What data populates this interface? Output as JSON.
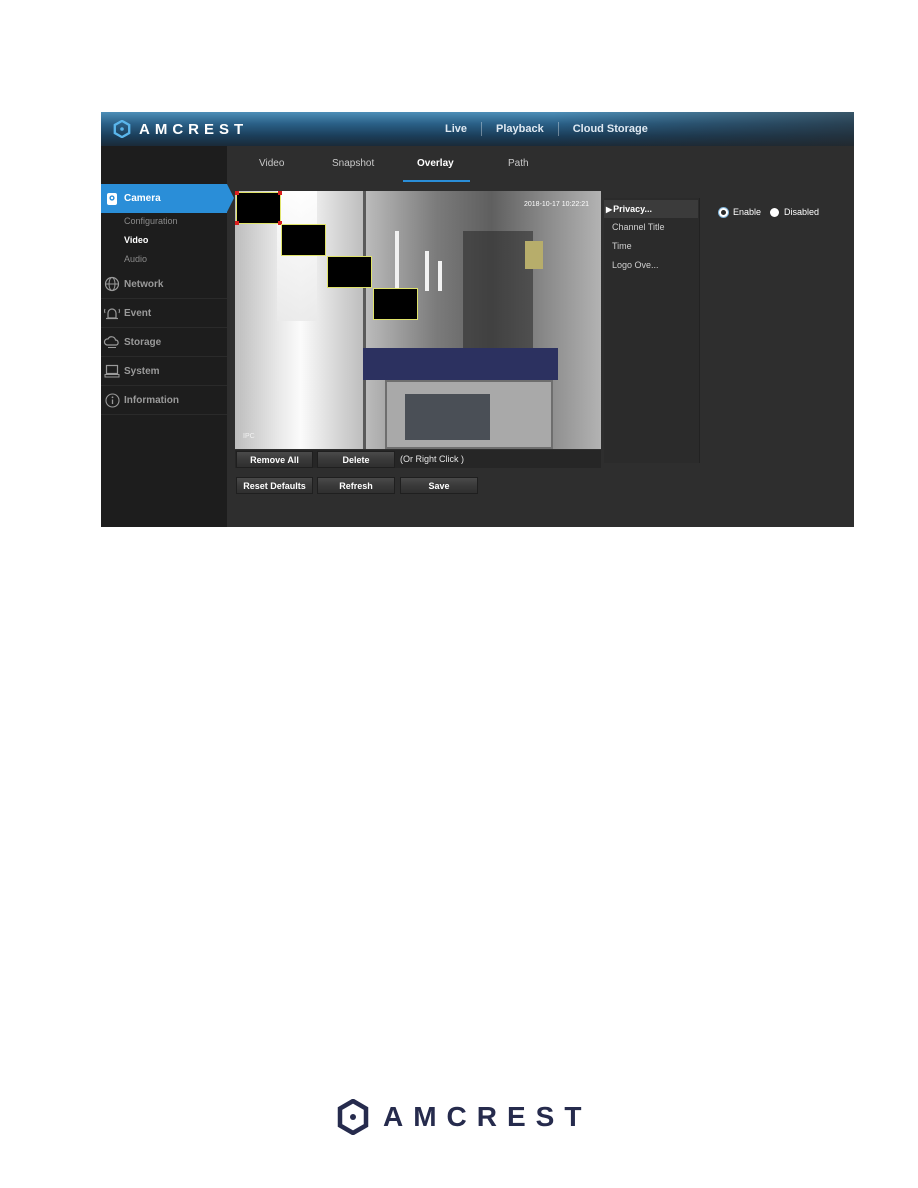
{
  "header": {
    "brand": "AMCREST",
    "nav": [
      {
        "label": "Live"
      },
      {
        "label": "Playback"
      },
      {
        "label": "Cloud Storage"
      }
    ]
  },
  "sidebar": {
    "items": [
      {
        "label": "Camera",
        "icon": "camera-icon",
        "active": true,
        "sub": [
          {
            "label": "Configuration",
            "active": false
          },
          {
            "label": "Video",
            "active": true
          },
          {
            "label": "Audio",
            "active": false
          }
        ]
      },
      {
        "label": "Network",
        "icon": "network-globe-icon"
      },
      {
        "label": "Event",
        "icon": "alarm-bell-icon"
      },
      {
        "label": "Storage",
        "icon": "cloud-icon"
      },
      {
        "label": "System",
        "icon": "computer-icon"
      },
      {
        "label": "Information",
        "icon": "info-icon"
      }
    ]
  },
  "tabs": [
    {
      "label": "Video",
      "active": false
    },
    {
      "label": "Snapshot",
      "active": false
    },
    {
      "label": "Overlay",
      "active": true
    },
    {
      "label": "Path",
      "active": false
    }
  ],
  "video": {
    "timestamp": "2018-10-17 10:22:21",
    "channel_label": "IPC",
    "privacy_masks": 4
  },
  "buttons": {
    "remove_all": "Remove All",
    "delete": "Delete",
    "delete_hint": "(Or Right Click )",
    "reset_defaults": "Reset Defaults",
    "refresh": "Refresh",
    "save": "Save"
  },
  "overlay_list": [
    {
      "label": "Privacy...",
      "active": true
    },
    {
      "label": "Channel Title",
      "active": false
    },
    {
      "label": "Time",
      "active": false
    },
    {
      "label": "Logo Ove...",
      "active": false
    }
  ],
  "privacy_mode": {
    "options": [
      {
        "label": "Enable",
        "checked": true
      },
      {
        "label": "Disabled",
        "checked": false
      }
    ]
  },
  "colors": {
    "accent": "#2a8ed8",
    "mask_border": "#e0e36a",
    "mask_handle": "#d91e1e",
    "footer_brand": "#262b4d"
  },
  "footer": {
    "brand": "AMCREST"
  }
}
